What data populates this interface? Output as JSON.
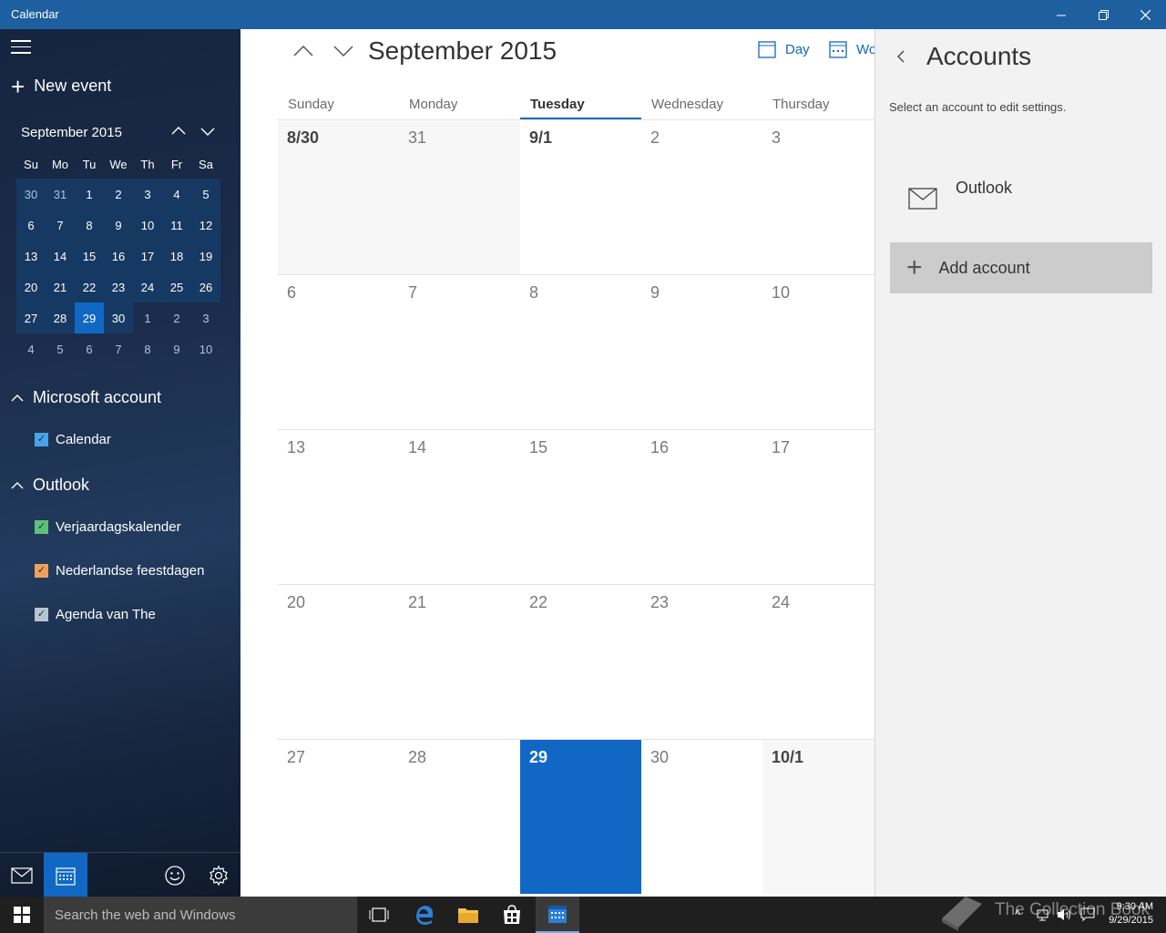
{
  "window": {
    "title": "Calendar"
  },
  "sidebar": {
    "new_event": "New event",
    "mini_calendar": {
      "month_label": "September 2015",
      "weekdays": [
        "Su",
        "Mo",
        "Tu",
        "We",
        "Th",
        "Fr",
        "Sa"
      ],
      "days": [
        [
          "30",
          "31",
          "1",
          "2",
          "3",
          "4",
          "5"
        ],
        [
          "6",
          "7",
          "8",
          "9",
          "10",
          "11",
          "12"
        ],
        [
          "13",
          "14",
          "15",
          "16",
          "17",
          "18",
          "19"
        ],
        [
          "20",
          "21",
          "22",
          "23",
          "24",
          "25",
          "26"
        ],
        [
          "27",
          "28",
          "29",
          "30",
          "1",
          "2",
          "3"
        ],
        [
          "4",
          "5",
          "6",
          "7",
          "8",
          "9",
          "10"
        ]
      ],
      "selected_day": "29"
    },
    "groups": [
      {
        "name": "Microsoft account",
        "calendars": [
          {
            "name": "Calendar",
            "color": "#4aa3e8",
            "checked": true
          }
        ]
      },
      {
        "name": "Outlook",
        "calendars": [
          {
            "name": "Verjaardagskalender",
            "color": "#5fc178",
            "checked": true
          },
          {
            "name": "Nederlandse feestdagen",
            "color": "#f0a05a",
            "checked": true
          },
          {
            "name": "Agenda van The",
            "color": "#b9c4cf",
            "checked": true
          }
        ]
      }
    ]
  },
  "main": {
    "month_title": "September 2015",
    "views": {
      "day": "Day",
      "work_week": "Wor"
    },
    "weekdays": [
      "Sunday",
      "Monday",
      "Tuesday",
      "Wednesday",
      "Thursday"
    ],
    "selected_weekday": "Tuesday",
    "weeks": [
      [
        "8/30",
        "31",
        "9/1",
        "2",
        "3"
      ],
      [
        "6",
        "7",
        "8",
        "9",
        "10"
      ],
      [
        "13",
        "14",
        "15",
        "16",
        "17"
      ],
      [
        "20",
        "21",
        "22",
        "23",
        "24"
      ],
      [
        "27",
        "28",
        "29",
        "30",
        "10/1"
      ]
    ],
    "today": "29"
  },
  "accounts_panel": {
    "title": "Accounts",
    "hint": "Select an account to edit settings.",
    "accounts": [
      "Outlook"
    ],
    "add_account": "Add account"
  },
  "taskbar": {
    "search_placeholder": "Search the web and Windows",
    "time": "9:30 AM",
    "date": "9/29/2015",
    "watermark": "The Collection Book"
  },
  "colors": {
    "accent": "#1068c4",
    "titlebar": "#1e5fa0"
  }
}
